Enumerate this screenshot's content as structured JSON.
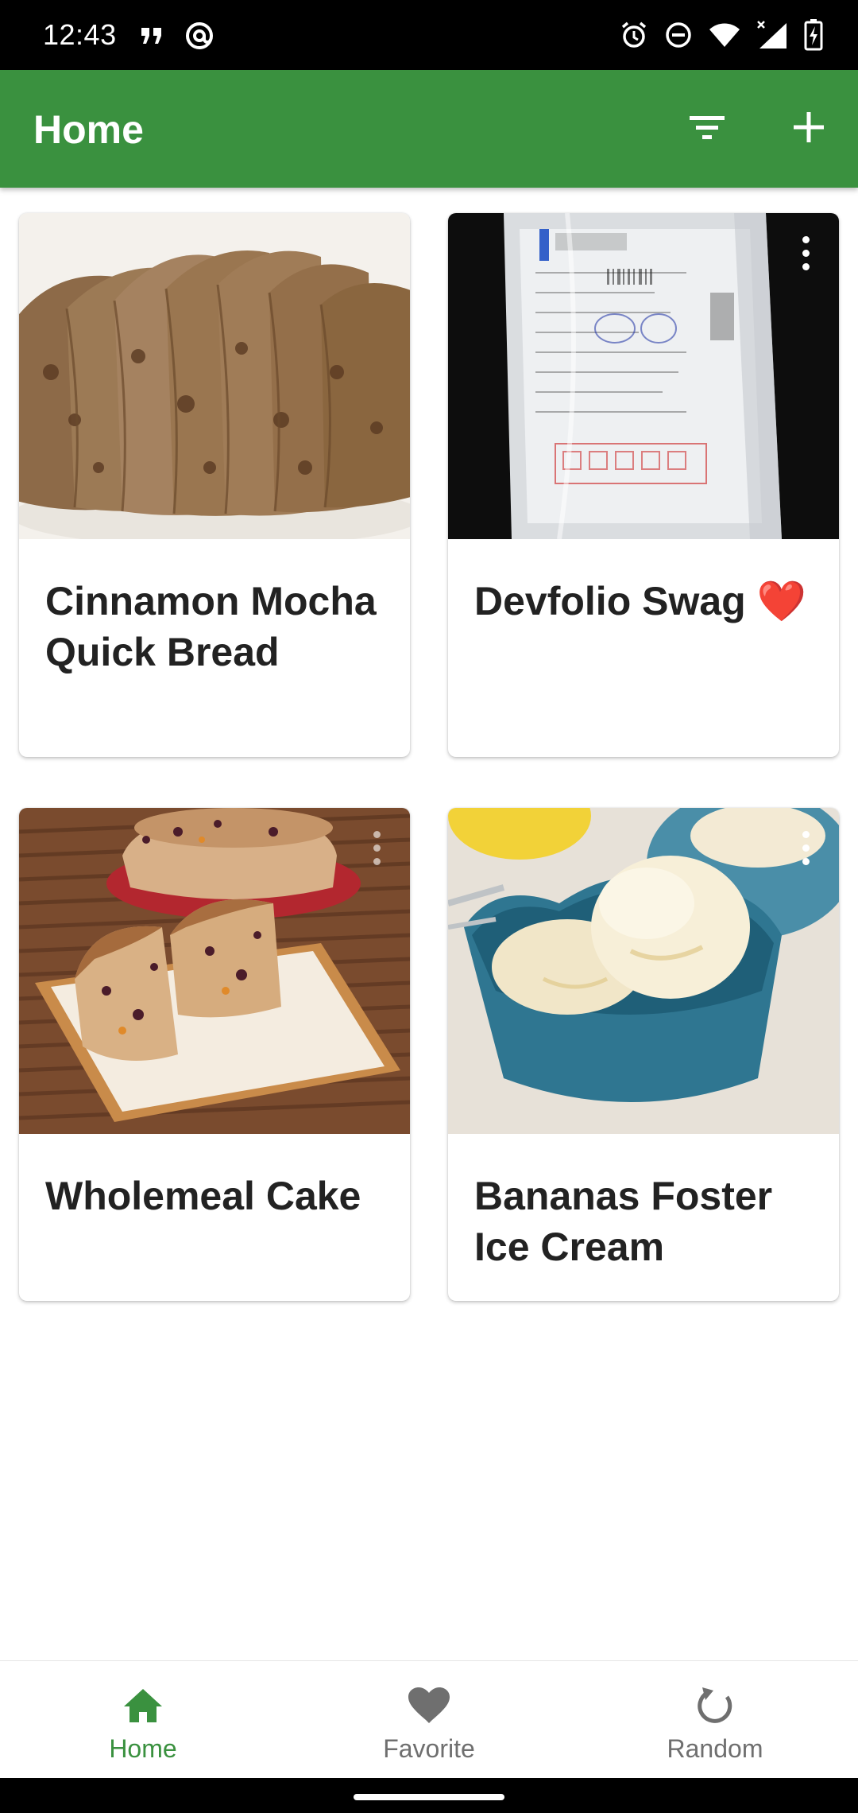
{
  "status_bar": {
    "time": "12:43",
    "left_icons": [
      "quote-notification-icon",
      "at-sign-icon"
    ],
    "right_icons": [
      "alarm-icon",
      "do-not-disturb-icon",
      "wifi-icon",
      "signal-icon",
      "battery-charging-icon"
    ]
  },
  "app_bar": {
    "title": "Home",
    "actions": [
      "filter-icon",
      "add-icon"
    ],
    "color": "#3a913f"
  },
  "recipes": [
    {
      "title": "Cinnamon Mocha Quick Bread",
      "image": "sliced quick bread photo"
    },
    {
      "title": "Devfolio Swag ❤️",
      "image": "devfolio courier package photo"
    },
    {
      "title": "Wholemeal Cake",
      "image": "wholemeal fruit cake photo"
    },
    {
      "title": "Bananas Foster Ice Cream",
      "image": "ice cream in blue bowl photo"
    }
  ],
  "bottom_nav": {
    "items": [
      {
        "label": "Home",
        "icon": "home-icon",
        "active": true
      },
      {
        "label": "Favorite",
        "icon": "heart-icon",
        "active": false
      },
      {
        "label": "Random",
        "icon": "refresh-icon",
        "active": false
      }
    ],
    "active_color": "#3a913f",
    "inactive_color": "#6f6f6f"
  }
}
